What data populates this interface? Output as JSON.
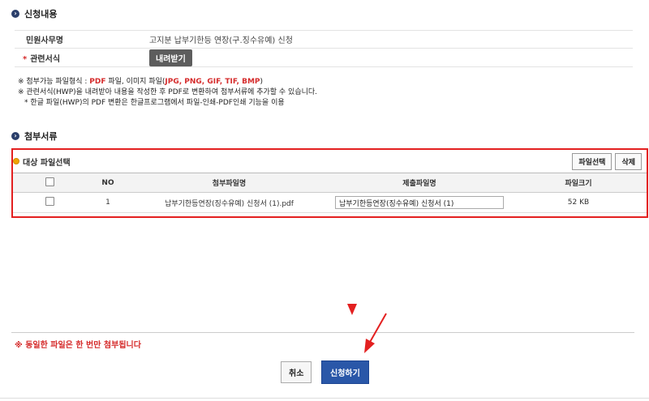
{
  "section1": {
    "title": "신청내용",
    "rows": [
      {
        "label": "민원사무명",
        "value": "고지분 납부기한등 연장(구.징수유예) 신청"
      },
      {
        "label": "관련서식",
        "required_mark": "*",
        "button": "내려받기"
      }
    ],
    "notes": {
      "line1_prefix": "※ 첨부가능 파일형식 : ",
      "line1_pdf": "PDF",
      "line1_mid": " 파일, 이미지 파일(",
      "line1_formats": "JPG, PNG, GIF, TIF, BMP",
      "line1_suffix": ")",
      "line2": "※ 관련서식(HWP)을 내려받아 내용을 작성한 후 PDF로 변환하여 첨부서류에 추가할 수 있습니다.",
      "line3": "* 한글 파일(HWP)의 PDF 변환은 한글프로그램에서 파일-인쇄-PDF인쇄 기능을 이용"
    }
  },
  "section2": {
    "title": "첨부서류",
    "box_title": "대상 파일선택",
    "select_button": "파일선택",
    "delete_button": "삭제",
    "columns": [
      "NO",
      "첨부파일명",
      "제출파일명",
      "파일크기"
    ],
    "rows": [
      {
        "no": "1",
        "attached": "납부기한등연장(징수유예) 신청서 (1).pdf",
        "submitted": "납부기한등연장(징수유예) 신청서 (1)",
        "size": "52 KB"
      }
    ]
  },
  "warning": "※ 동일한 파일은 한 번만 첨부됩니다",
  "buttons": {
    "cancel": "취소",
    "submit": "신청하기"
  },
  "colors": {
    "annotation_red": "#e32020",
    "primary_blue": "#2a57a8",
    "header_navy": "#2b3f6b"
  }
}
